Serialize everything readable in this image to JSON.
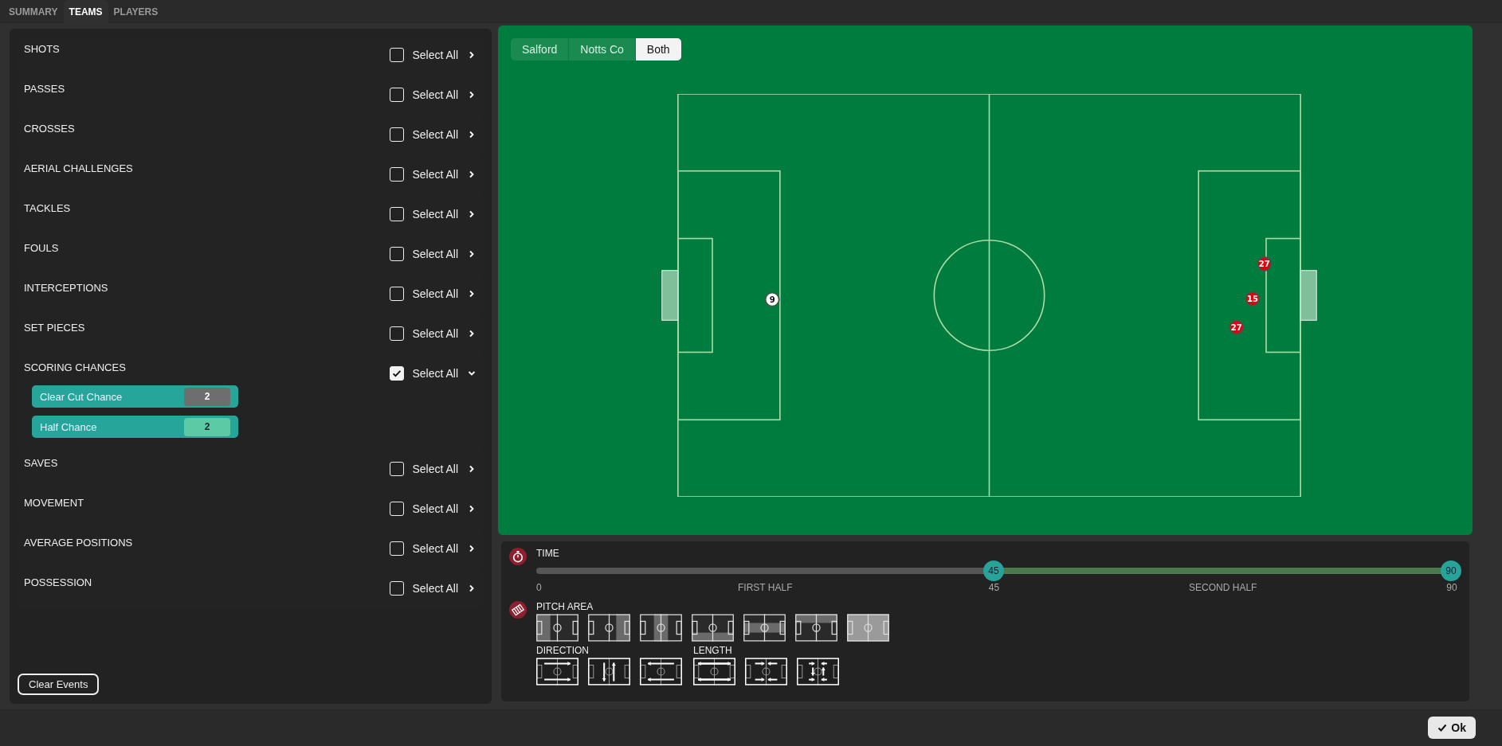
{
  "tabs": [
    {
      "label": "SUMMARY",
      "selected": false
    },
    {
      "label": "TEAMS",
      "selected": true
    },
    {
      "label": "PLAYERS",
      "selected": false
    }
  ],
  "event_groups": [
    {
      "label": "SHOTS",
      "select_all": "Select All",
      "checked": false,
      "expanded": false
    },
    {
      "label": "PASSES",
      "select_all": "Select All",
      "checked": false,
      "expanded": false
    },
    {
      "label": "CROSSES",
      "select_all": "Select All",
      "checked": false,
      "expanded": false
    },
    {
      "label": "AERIAL CHALLENGES",
      "select_all": "Select All",
      "checked": false,
      "expanded": false
    },
    {
      "label": "TACKLES",
      "select_all": "Select All",
      "checked": false,
      "expanded": false
    },
    {
      "label": "FOULS",
      "select_all": "Select All",
      "checked": false,
      "expanded": false
    },
    {
      "label": "INTERCEPTIONS",
      "select_all": "Select All",
      "checked": false,
      "expanded": false
    },
    {
      "label": "SET PIECES",
      "select_all": "Select All",
      "checked": false,
      "expanded": false
    },
    {
      "label": "SCORING CHANCES",
      "select_all": "Select All",
      "checked": true,
      "expanded": true,
      "children": [
        {
          "label": "Clear Cut Chance",
          "count": "2",
          "highlighted": false
        },
        {
          "label": "Half Chance",
          "count": "2",
          "highlighted": true
        }
      ]
    },
    {
      "label": "SAVES",
      "select_all": "Select All",
      "checked": false,
      "expanded": false
    },
    {
      "label": "MOVEMENT",
      "select_all": "Select All",
      "checked": false,
      "expanded": false
    },
    {
      "label": "AVERAGE POSITIONS",
      "select_all": "Select All",
      "checked": false,
      "expanded": false
    },
    {
      "label": "POSSESSION",
      "select_all": "Select All",
      "checked": false,
      "expanded": false
    }
  ],
  "clear_button": "Clear Events",
  "team_tabs": [
    {
      "label": "Salford",
      "selected": false
    },
    {
      "label": "Notts Co",
      "selected": false
    },
    {
      "label": "Both",
      "selected": true
    }
  ],
  "markers": [
    {
      "label": "9",
      "color": "#ffffff"
    },
    {
      "label": "27",
      "color": "#e00010"
    },
    {
      "label": "15",
      "color": "#e00010"
    },
    {
      "label": "27",
      "color": "#e00010"
    }
  ],
  "time": {
    "title": "TIME",
    "thumbs": [
      {
        "label": "45",
        "level": 0.5
      },
      {
        "label": "90",
        "level": 1
      }
    ],
    "scale": [
      {
        "label": "0",
        "level": 0
      },
      {
        "label": "FIRST HALF",
        "level": 0.25
      },
      {
        "label": "45",
        "level": 0.5
      },
      {
        "label": "SECOND HALF",
        "level": 0.75
      },
      {
        "label": "90",
        "level": 1
      }
    ]
  },
  "pitch_area": {
    "title": "PITCH AREA",
    "options": [
      {
        "kind": "left",
        "selected": false
      },
      {
        "kind": "right",
        "selected": false
      },
      {
        "kind": "centre",
        "selected": false
      },
      {
        "kind": "bottom",
        "selected": false
      },
      {
        "kind": "middle",
        "selected": false
      },
      {
        "kind": "top",
        "selected": false
      },
      {
        "kind": "all",
        "selected": true
      }
    ]
  },
  "direction": {
    "title": "DIRECTION",
    "options": [
      {
        "kind": "forward"
      },
      {
        "kind": "vertical"
      },
      {
        "kind": "backward"
      }
    ]
  },
  "length": {
    "title": "LENGTH",
    "options": [
      {
        "kind": "long"
      },
      {
        "kind": "medium"
      },
      {
        "kind": "short"
      }
    ]
  },
  "ok_button": "Ok"
}
